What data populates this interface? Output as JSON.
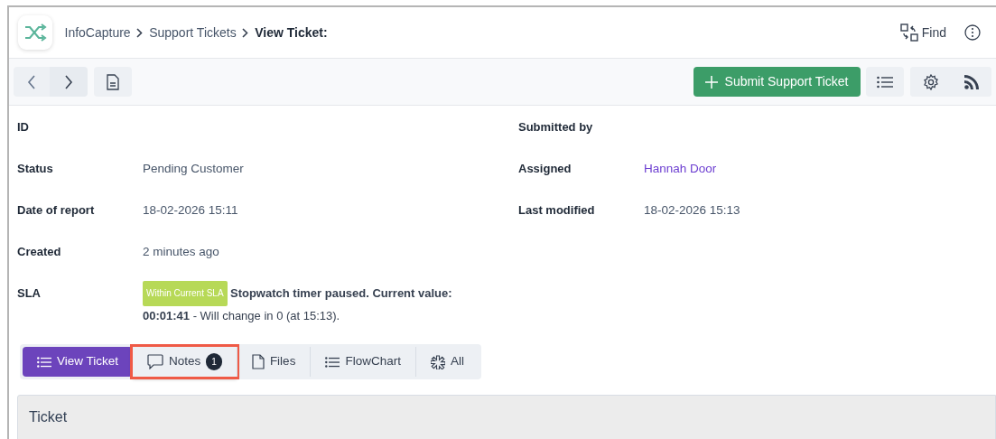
{
  "breadcrumb": [
    {
      "label": "InfoCapture",
      "current": false
    },
    {
      "label": "Support Tickets",
      "current": false
    },
    {
      "label": "View Ticket:",
      "current": true
    }
  ],
  "find": "Find",
  "submit_button": "Submit Support Ticket",
  "fields_left": [
    {
      "label": "ID"
    },
    {
      "label": "Status",
      "value": "Pending Customer",
      "kind": "text"
    },
    {
      "label": "Date of report",
      "value": "18-02-2026 15:11",
      "kind": "text"
    },
    {
      "label": "Created",
      "value": "2 minutes ago",
      "kind": "text"
    }
  ],
  "fields_right": [
    {
      "label": "Submitted by"
    },
    {
      "label": "Assigned",
      "value": "Hannah Door",
      "kind": "link"
    },
    {
      "label": "Last modified",
      "value": "18-02-2026 15:13",
      "kind": "text"
    }
  ],
  "sla": {
    "label": "SLA",
    "badge": "Within Current SLA",
    "message": "**Stopwatch timer paused. Current value:**",
    "detail": "**00:01:41** - Will change in 0 (at 15:13)."
  },
  "tabs": [
    {
      "label": "View Ticket",
      "selected": true,
      "highlighted": false
    },
    {
      "label": "Notes",
      "selected": false,
      "highlighted": true,
      "count": "1"
    },
    {
      "label": "Files",
      "selected": false,
      "highlighted": false
    },
    {
      "label": "FlowChart",
      "selected": false,
      "highlighted": false
    },
    {
      "label": "All",
      "selected": false,
      "highlighted": false
    }
  ],
  "card": {
    "title": "Ticket"
  }
}
